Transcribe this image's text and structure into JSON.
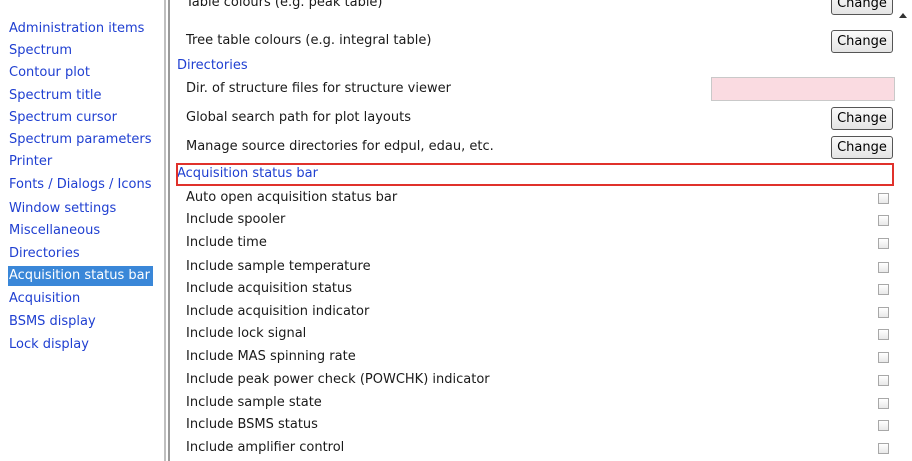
{
  "sidebar": {
    "items": [
      {
        "label": "Administration items"
      },
      {
        "label": "Spectrum"
      },
      {
        "label": "Contour plot"
      },
      {
        "label": "Spectrum title"
      },
      {
        "label": "Spectrum cursor"
      },
      {
        "label": "Spectrum parameters"
      },
      {
        "label": "Printer"
      },
      {
        "label": "Fonts / Dialogs / Icons"
      },
      {
        "label": "Window settings"
      },
      {
        "label": "Miscellaneous"
      },
      {
        "label": "Directories"
      },
      {
        "label": "Acquisition status bar",
        "selected": true
      },
      {
        "label": "Acquisition"
      },
      {
        "label": "BSMS display"
      },
      {
        "label": "Lock display"
      }
    ]
  },
  "main": {
    "colours_rows": [
      {
        "label": "Table colours (e.g. peak table)",
        "button": "Change"
      },
      {
        "label": "Tree table colours (e.g. integral table)",
        "button": "Change"
      }
    ],
    "directories_header": "Directories",
    "directories_rows": [
      {
        "label": "Dir. of structure files for structure viewer",
        "value": ""
      },
      {
        "label": "Global search path for plot layouts",
        "button": "Change"
      },
      {
        "label": "Manage source directories for edpul, edau, etc.",
        "button": "Change"
      }
    ],
    "acq_header": "Acquisition status bar",
    "acq_rows": [
      {
        "label": "Auto open acquisition status bar",
        "checked": false
      },
      {
        "label": "Include spooler",
        "checked": false
      },
      {
        "label": "Include time",
        "checked": false
      },
      {
        "label": "Include sample temperature",
        "checked": false
      },
      {
        "label": "Include acquisition status",
        "checked": false
      },
      {
        "label": "Include acquisition indicator",
        "checked": false
      },
      {
        "label": "Include lock signal",
        "checked": false
      },
      {
        "label": "Include MAS spinning rate",
        "checked": false
      },
      {
        "label": "Include peak power check (POWCHK) indicator",
        "checked": false
      },
      {
        "label": "Include sample state",
        "checked": false
      },
      {
        "label": "Include BSMS status",
        "checked": false
      },
      {
        "label": "Include amplifier control",
        "checked": false
      }
    ]
  },
  "colors": {
    "link": "#1f3fd1",
    "selection": "#3a87d8",
    "highlight_border": "#e0312b",
    "field_bg": "#fadbe1"
  }
}
